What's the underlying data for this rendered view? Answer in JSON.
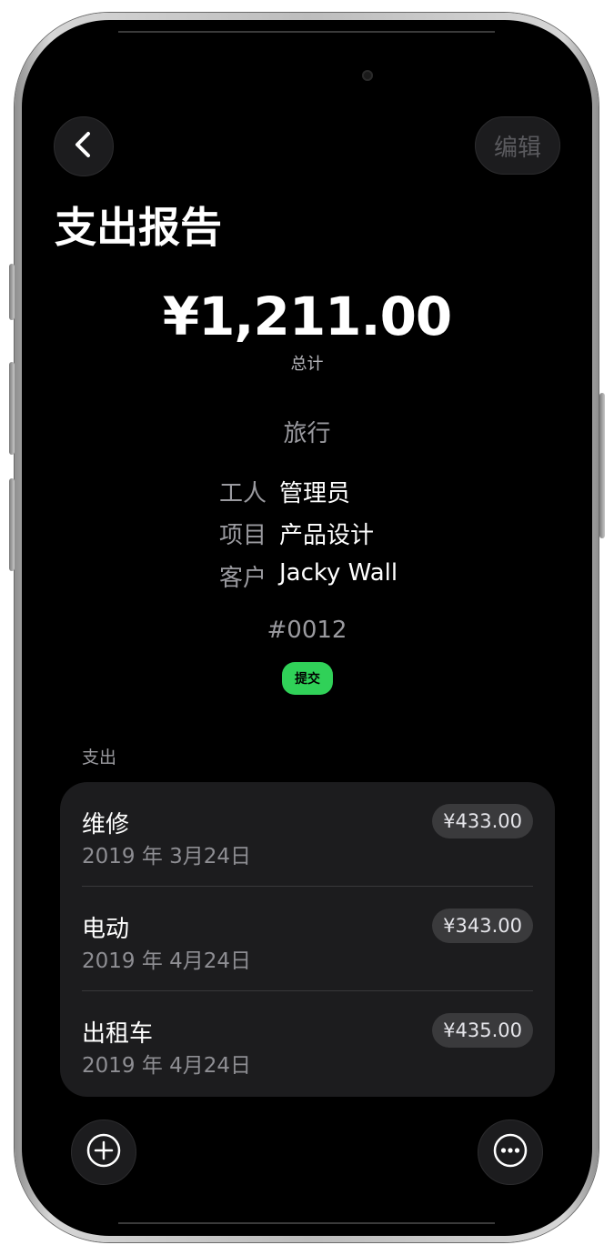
{
  "header": {
    "edit_label": "编辑",
    "title": "支出报告"
  },
  "summary": {
    "total": "¥1,211.00",
    "total_label": "总计",
    "category": "旅行"
  },
  "meta": [
    {
      "key": "工人",
      "value": "管理员"
    },
    {
      "key": "项目",
      "value": "产品设计"
    },
    {
      "key": "客户",
      "value": "Jacky Wall"
    }
  ],
  "report_id": "#0012",
  "status": {
    "label": "提交",
    "color": "#30d158"
  },
  "expenses": {
    "section_label": "支出",
    "items": [
      {
        "name": "维修",
        "date": "2019 年 3月24日",
        "amount": "¥433.00"
      },
      {
        "name": "电动",
        "date": "2019 年 4月24日",
        "amount": "¥343.00"
      },
      {
        "name": "出租车",
        "date": "2019 年 4月24日",
        "amount": "¥435.00"
      }
    ]
  },
  "icons": {
    "back": "chevron-left-icon",
    "add": "plus-circle-icon",
    "more": "ellipsis-circle-icon"
  }
}
